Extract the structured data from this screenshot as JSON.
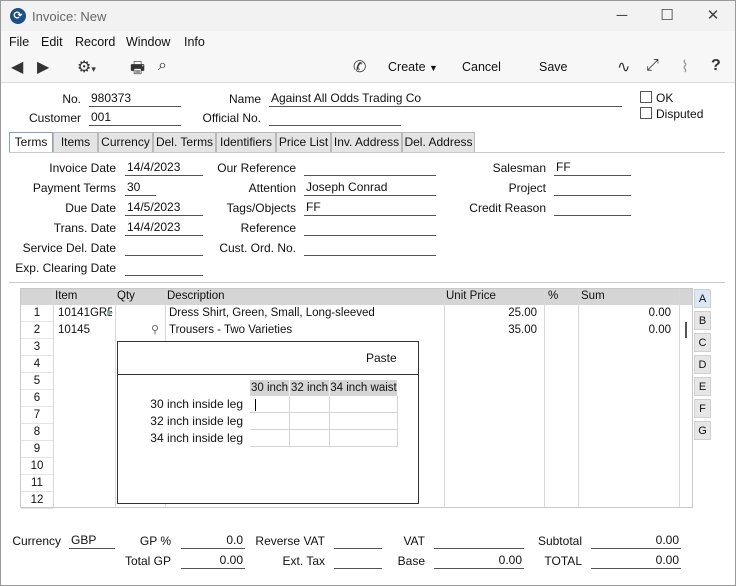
{
  "window": {
    "title": "Invoice: New",
    "icon": "app-logo-icon",
    "controls": [
      "minimize-icon",
      "maximize-icon",
      "close-icon"
    ]
  },
  "menubar": [
    "File",
    "Edit",
    "Record",
    "Window",
    "Info"
  ],
  "toolbar": {
    "create_label": "Create",
    "cancel_label": "Cancel",
    "save_label": "Save"
  },
  "header": {
    "no_label": "No.",
    "no_value": "980373",
    "name_label": "Name",
    "name_value": "Against All Odds Trading Co",
    "customer_label": "Customer",
    "customer_value": "001",
    "official_no_label": "Official No.",
    "official_no_value": "",
    "ok_label": "OK",
    "disputed_label": "Disputed"
  },
  "tabs": [
    "Terms",
    "Items",
    "Currency",
    "Del. Terms",
    "Identifiers",
    "Price List",
    "Inv. Address",
    "Del. Address"
  ],
  "terms": {
    "invoice_date_label": "Invoice Date",
    "invoice_date": "14/4/2023",
    "payment_terms_label": "Payment Terms",
    "payment_terms": "30",
    "due_date_label": "Due Date",
    "due_date": "14/5/2023",
    "trans_date_label": "Trans. Date",
    "trans_date": "14/4/2023",
    "service_del_date_label": "Service Del. Date",
    "service_del_date": "",
    "exp_clearing_date_label": "Exp. Clearing Date",
    "exp_clearing_date": "",
    "our_reference_label": "Our Reference",
    "our_reference": "",
    "attention_label": "Attention",
    "attention": "Joseph Conrad",
    "tags_label": "Tags/Objects",
    "tags": "FF",
    "reference_label": "Reference",
    "reference": "",
    "cust_ord_no_label": "Cust. Ord. No.",
    "cust_ord_no": "",
    "salesman_label": "Salesman",
    "salesman": "FF",
    "project_label": "Project",
    "project": "",
    "credit_reason_label": "Credit Reason",
    "credit_reason": ""
  },
  "grid": {
    "columns": [
      "Item",
      "Qty",
      "Description",
      "Unit Price",
      "%",
      "Sum"
    ],
    "rows": [
      {
        "n": "1",
        "item": "10141GRE",
        "qty": "",
        "description": "Dress Shirt, Green, Small, Long-sleeved",
        "unit_price": "25.00",
        "pct": "",
        "sum": "0.00"
      },
      {
        "n": "2",
        "item": "10145",
        "qty": "",
        "description": "Trousers - Two Varieties",
        "unit_price": "35.00",
        "pct": "",
        "sum": "0.00"
      },
      {
        "n": "3"
      },
      {
        "n": "4"
      },
      {
        "n": "5"
      },
      {
        "n": "6"
      },
      {
        "n": "7"
      },
      {
        "n": "8"
      },
      {
        "n": "9"
      },
      {
        "n": "10"
      },
      {
        "n": "11"
      },
      {
        "n": "12"
      }
    ],
    "side_buttons": [
      "A",
      "B",
      "C",
      "D",
      "E",
      "F",
      "G"
    ]
  },
  "popup": {
    "paste_label": "Paste",
    "col_headers": [
      "30 inch",
      "32 inch",
      "34 inch waist"
    ],
    "row_labels": [
      "30 inch inside leg",
      "32 inch inside leg",
      "34 inch inside leg"
    ]
  },
  "footer": {
    "currency_label": "Currency",
    "currency": "GBP",
    "gp_pct_label": "GP %",
    "gp_pct": "0.0",
    "total_gp_label": "Total GP",
    "total_gp": "0.00",
    "reverse_vat_label": "Reverse VAT",
    "reverse_vat": "",
    "ext_tax_label": "Ext. Tax",
    "ext_tax": "",
    "vat_label": "VAT",
    "vat": "",
    "base_label": "Base",
    "base": "0.00",
    "subtotal_label": "Subtotal",
    "subtotal": "0.00",
    "total_label": "TOTAL",
    "total": "0.00"
  }
}
